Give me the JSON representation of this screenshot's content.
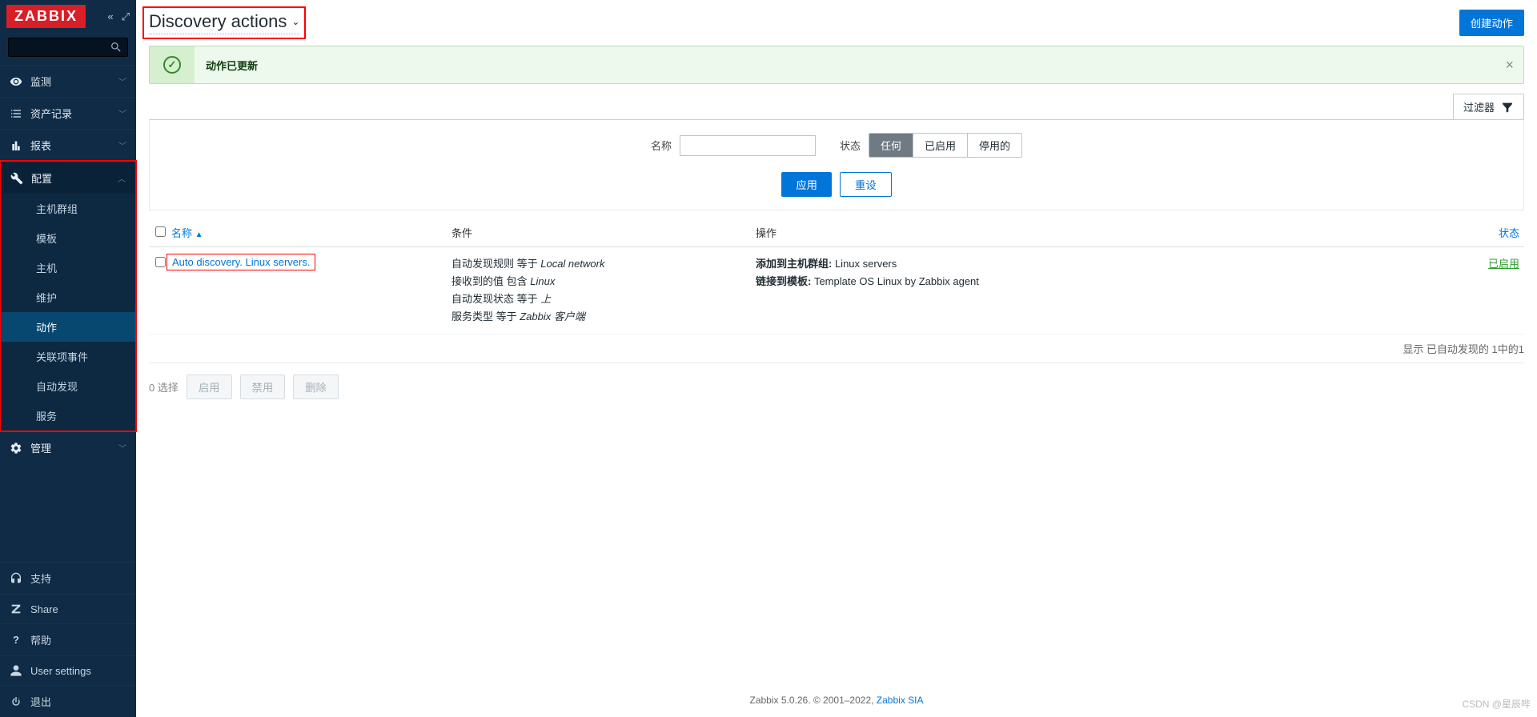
{
  "logo": "ZABBIX",
  "nav": {
    "monitoring": "监测",
    "inventory": "资产记录",
    "reports": "报表",
    "config": "配置",
    "config_sub": [
      "主机群组",
      "模板",
      "主机",
      "维护",
      "动作",
      "关联项事件",
      "自动发现",
      "服务"
    ],
    "admin": "管理",
    "support": "支持",
    "share": "Share",
    "help": "帮助",
    "user": "User settings",
    "logout": "退出"
  },
  "page": {
    "title": "Discovery actions",
    "create_btn": "创建动作",
    "msg": "动作已更新",
    "filter_tab": "过滤器",
    "filter": {
      "name_label": "名称",
      "name_value": "",
      "status_label": "状态",
      "opts": [
        "任何",
        "已启用",
        "停用的"
      ],
      "apply": "应用",
      "reset": "重设"
    },
    "cols": {
      "name": "名称",
      "cond": "条件",
      "op": "操作",
      "status": "状态"
    },
    "rows": [
      {
        "name": "Auto discovery. Linux servers.",
        "conds": [
          {
            "p": "自动发现规则 等于 ",
            "i": "Local network"
          },
          {
            "p": "接收到的值 包含 ",
            "i": "Linux"
          },
          {
            "p": "自动发现状态 等于 ",
            "i": "上"
          },
          {
            "p": "服务类型 等于 ",
            "i": "Zabbix 客户端"
          }
        ],
        "ops": [
          {
            "b": "添加到主机群组: ",
            "t": "Linux servers"
          },
          {
            "b": "链接到模板: ",
            "t": "Template OS Linux by Zabbix agent"
          }
        ],
        "status": "已启用"
      }
    ],
    "foot": "显示 已自动发现的 1中的1",
    "bulk": {
      "sel": "0 选择",
      "enable": "启用",
      "disable": "禁用",
      "delete": "删除"
    },
    "copyright_a": "Zabbix 5.0.26. © 2001–2022, ",
    "copyright_b": "Zabbix SIA"
  },
  "watermark": "CSDN @星辰哔"
}
